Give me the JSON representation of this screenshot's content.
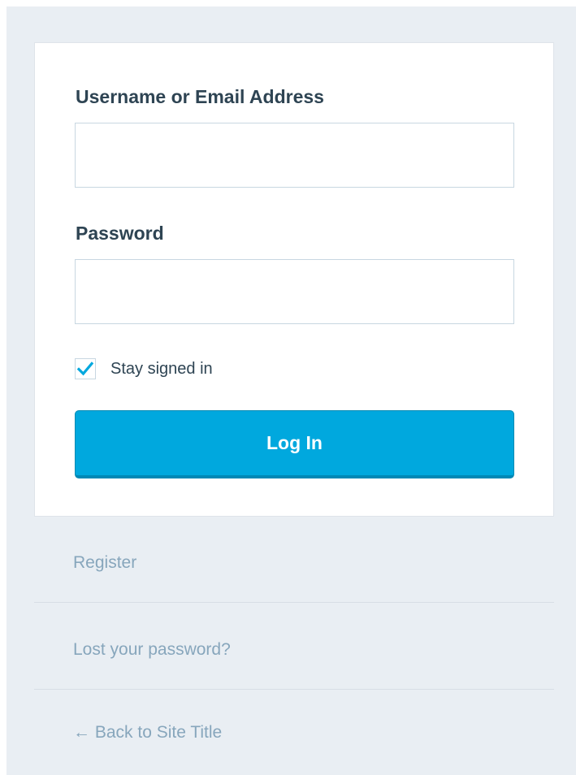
{
  "login_form": {
    "username_label": "Username or Email Address",
    "username_value": "",
    "password_label": "Password",
    "password_value": "",
    "remember_label": "Stay signed in",
    "remember_checked": true,
    "submit_label": "Log In"
  },
  "footer_links": {
    "register": "Register",
    "lost_password": "Lost your password?",
    "back_to_site": "← Back to Site Title"
  },
  "colors": {
    "page_background": "#e9eef3",
    "card_background": "#ffffff",
    "primary_button": "#00a8de",
    "checkmark": "#00a8de",
    "label_text": "#2e4453",
    "link_text": "#87a6bc"
  },
  "icons": {
    "checkbox_mark": "checkmark-icon"
  }
}
